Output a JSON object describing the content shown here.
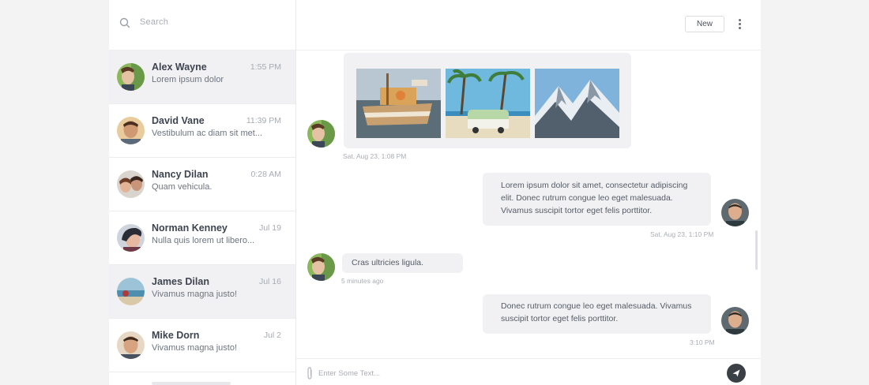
{
  "search": {
    "placeholder": "Search",
    "icon": "search-icon"
  },
  "contacts": [
    {
      "name": "Alex Wayne",
      "preview": "Lorem ipsum dolor",
      "time": "1:55 PM",
      "active": true
    },
    {
      "name": "David Vane",
      "preview": "Vestibulum ac diam sit met...",
      "time": "11:39 PM",
      "active": false
    },
    {
      "name": "Nancy Dilan",
      "preview": "Quam vehicula.",
      "time": "0:28 AM",
      "active": false
    },
    {
      "name": "Norman Kenney",
      "preview": "Nulla quis lorem ut libero...",
      "time": "Jul 19",
      "active": false
    },
    {
      "name": "James Dilan",
      "preview": "Vivamus magna justo!",
      "time": "Jul 16",
      "active": true
    },
    {
      "name": "Mike Dorn",
      "preview": "Vivamus magna justo!",
      "time": "Jul 2",
      "active": false
    }
  ],
  "header": {
    "new_label": "New",
    "more_icon": "more-vertical-icon"
  },
  "messages": {
    "photos_stamp": "Sat, Aug 23, 1:08 PM",
    "reply1_text": "Lorem ipsum dolor sit amet, consectetur adipiscing elit. Donec rutrum congue leo eget malesuada. Vivamus suscipit tortor eget felis porttitor.",
    "reply1_stamp": "Sat, Aug 23, 1:10 PM",
    "incoming2_text": "Cras ultricies ligula.",
    "incoming2_stamp": "5 minutes ago",
    "reply2_text": "Donec rutrum congue leo eget malesuada. Vivamus suscipit tortor eget felis porttitor.",
    "reply2_stamp": "3:10 PM"
  },
  "composer": {
    "placeholder": "Enter Some Text...",
    "attach_icon": "paperclip-icon",
    "send_icon": "send-icon"
  },
  "colors": {
    "active_row": "#f1f1f3",
    "bubble": "#f1f1f3",
    "send_button": "#3b3f46"
  }
}
